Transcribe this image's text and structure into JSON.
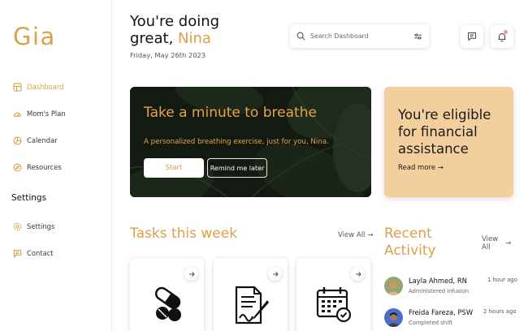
{
  "app": {
    "logo": "Gia"
  },
  "sidebar": {
    "items": [
      {
        "label": "Dashboard",
        "icon": "grid-icon"
      },
      {
        "label": "Mom's Plan",
        "icon": "gauge-icon"
      },
      {
        "label": "Calendar",
        "icon": "pie-icon"
      },
      {
        "label": "Resources",
        "icon": "compass-icon"
      }
    ],
    "settings_heading": "Settings",
    "settings_items": [
      {
        "label": "Settings",
        "icon": "gear-icon"
      },
      {
        "label": "Contact",
        "icon": "chat-icon"
      }
    ]
  },
  "header": {
    "greeting": "You're doing",
    "greeting2": "great, ",
    "name": "Nina",
    "date": "Friday, May 26th 2023"
  },
  "search": {
    "placeholder": "Search Dashboard"
  },
  "breathe": {
    "title": "Take a minute to breathe",
    "subtitle": "A personalized breathing exercise, just for you, Nina.",
    "start_label": "Start",
    "later_label": "Remind me later"
  },
  "finance": {
    "title": "You're eligible for financial assistance",
    "link_label": "Read more →"
  },
  "tasks": {
    "title": "Tasks this week",
    "view_all": "View All",
    "cards": [
      {
        "icon": "pill-capsule-icon"
      },
      {
        "icon": "contract-sign-icon"
      },
      {
        "icon": "calendar-check-icon"
      }
    ]
  },
  "activity": {
    "title_line1": "Recent",
    "title_line2": "Activity",
    "view_all_line1": "View",
    "view_all_line2": "All",
    "items": [
      {
        "name": "Layla Ahmed, RN",
        "desc": "Administered infusion",
        "time": "1 hour ago"
      },
      {
        "name": "Freida Fareza, PSW",
        "desc": "Completed shift",
        "time": "2 hours ago"
      }
    ]
  },
  "colors": {
    "accent": "#d9a24a",
    "finance_bg": "#f3cf9e",
    "card_dark": "#141b12"
  }
}
